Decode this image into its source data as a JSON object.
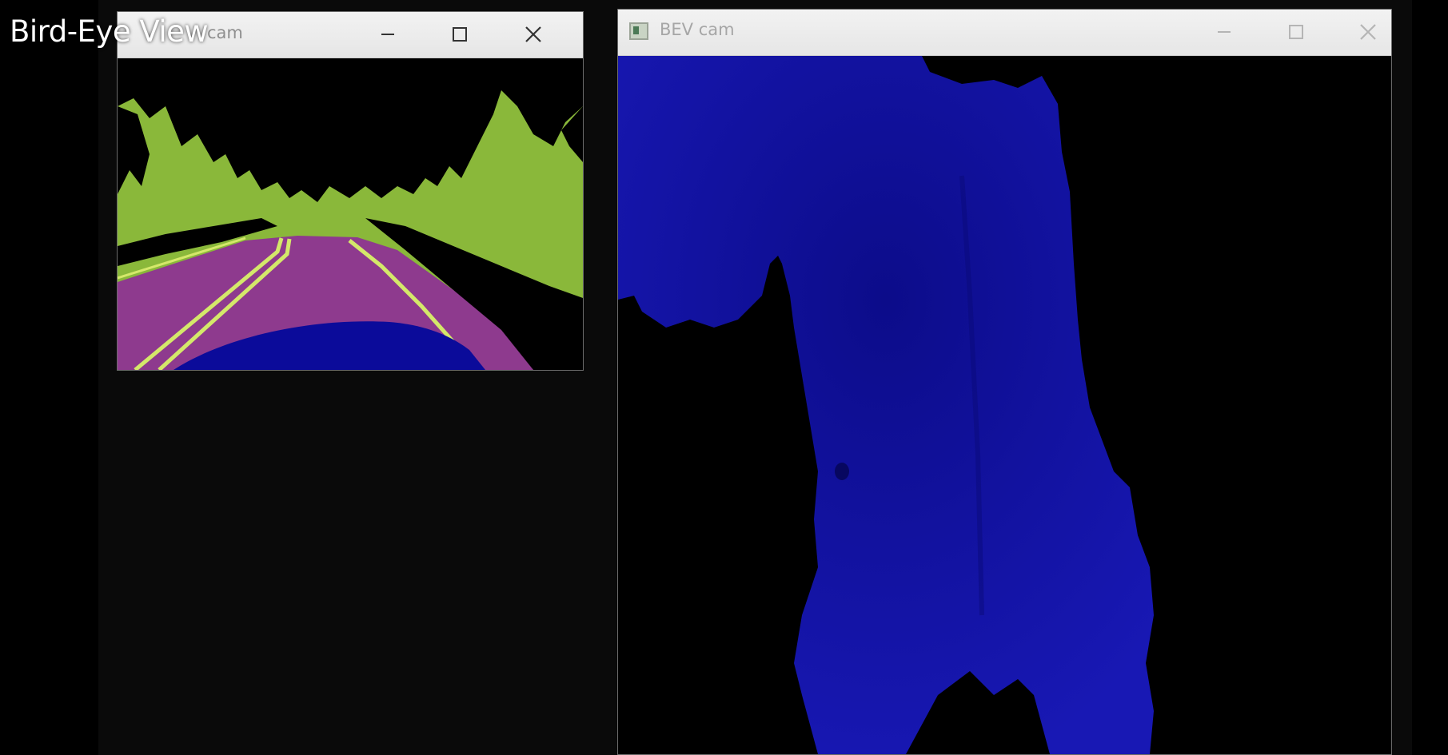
{
  "overlay": {
    "title": "Bird-Eye View"
  },
  "windows": {
    "left": {
      "title": "cam",
      "icon": "app-window-icon",
      "controls": {
        "minimize": "minimize-icon",
        "maximize": "maximize-icon",
        "close": "close-icon"
      }
    },
    "right": {
      "title": "BEV cam",
      "icon": "app-window-icon",
      "controls": {
        "minimize": "minimize-icon",
        "maximize": "maximize-icon",
        "close": "close-icon"
      }
    }
  },
  "colors": {
    "vegetation": "#8ab83a",
    "road": "#8e3a8e",
    "road_line": "#d4e86a",
    "vehicle": "#0b0b9a",
    "bev_blue": "#1414a8",
    "sky": "#000000"
  }
}
